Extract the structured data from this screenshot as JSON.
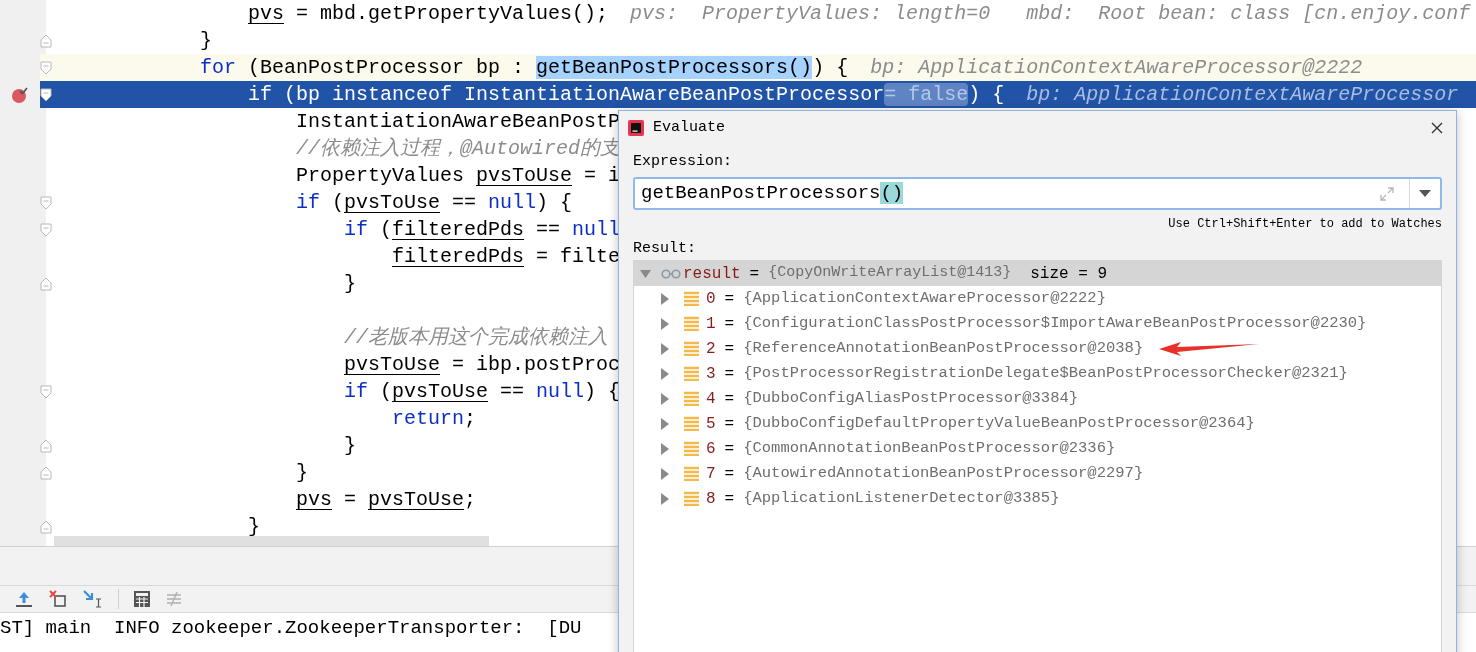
{
  "editor": {
    "lines": [
      {
        "children": [
          {
            "kind": "code",
            "code": [
              {
                "kind": "var",
                "text": "pvs"
              },
              {
                "kind": "text",
                "text": " = mbd.getPropertyValues();"
              }
            ],
            "hint": "pvs:  PropertyValues: length=0   mbd:  Root bean: class [cn.enjoy.conf"
          }
        ]
      },
      {
        "kind": "code",
        "fold_close": true,
        "code": [
          {
            "kind": "text",
            "text": "}"
          }
        ]
      },
      {
        "kind": "code",
        "caret": true,
        "fold_open": true,
        "code": [
          {
            "kind": "kw",
            "text": "for"
          },
          {
            "kind": "text",
            "text": " (BeanPostProcessor bp : "
          },
          {
            "kind": "sel",
            "text": "getBeanPostProcessors()"
          },
          {
            "kind": "text",
            "text": ") {"
          }
        ],
        "hint": "bp: ApplicationContextAwareProcessor@2222",
        "children": [
          {
            "kind": "code",
            "breakpoint": true,
            "current": true,
            "fold_open": true,
            "code": [
              {
                "kind": "kw",
                "text": "if"
              },
              {
                "kind": "text",
                "text": " (bp "
              },
              {
                "kind": "kw",
                "text": "instanceof"
              },
              {
                "kind": "text",
                "text": " InstantiationAwareBeanPostProcessor"
              },
              {
                "kind": "pill",
                "text": "= false"
              },
              {
                "kind": "text",
                "text": ") {"
              }
            ],
            "hint": "bp: ApplicationContextAwareProcessor",
            "children": [
              {
                "kind": "code",
                "code": [
                  {
                    "kind": "text",
                    "text": "InstantiationAwareBeanPostP"
                  }
                ]
              },
              {
                "kind": "code",
                "code": [
                  {
                    "kind": "comment",
                    "text": "//依赖注入过程，@Autowired的支"
                  }
                ]
              },
              {
                "kind": "code",
                "code": [
                  {
                    "kind": "text",
                    "text": "PropertyValues "
                  },
                  {
                    "kind": "var",
                    "text": "pvsToUse"
                  },
                  {
                    "kind": "text",
                    "text": " = i"
                  }
                ]
              },
              {
                "kind": "code",
                "fold_open": true,
                "code": [
                  {
                    "kind": "kw",
                    "text": "if"
                  },
                  {
                    "kind": "text",
                    "text": " ("
                  },
                  {
                    "kind": "var",
                    "text": "pvsToUse"
                  },
                  {
                    "kind": "text",
                    "text": " == "
                  },
                  {
                    "kind": "kw",
                    "text": "null"
                  },
                  {
                    "kind": "text",
                    "text": ") {"
                  }
                ],
                "children": [
                  {
                    "kind": "code",
                    "fold_open": true,
                    "code": [
                      {
                        "kind": "kw",
                        "text": "if"
                      },
                      {
                        "kind": "text",
                        "text": " ("
                      },
                      {
                        "kind": "var",
                        "text": "filteredPds"
                      },
                      {
                        "kind": "text",
                        "text": " == "
                      },
                      {
                        "kind": "kw",
                        "text": "null"
                      }
                    ],
                    "children": [
                      {
                        "kind": "code",
                        "code": [
                          {
                            "kind": "var",
                            "text": "filteredPds"
                          },
                          {
                            "kind": "text",
                            "text": " = filte"
                          }
                        ]
                      }
                    ]
                  },
                  {
                    "kind": "code",
                    "fold_close": true,
                    "code": [
                      {
                        "kind": "text",
                        "text": "}"
                      }
                    ]
                  },
                  {
                    "kind": "blank"
                  },
                  {
                    "kind": "code",
                    "code": [
                      {
                        "kind": "comment",
                        "text": "//老版本用这个完成依赖注入"
                      }
                    ]
                  },
                  {
                    "kind": "code",
                    "code": [
                      {
                        "kind": "var",
                        "text": "pvsToUse"
                      },
                      {
                        "kind": "text",
                        "text": " = ibp.postProc"
                      }
                    ]
                  },
                  {
                    "kind": "code",
                    "fold_open": true,
                    "code": [
                      {
                        "kind": "kw",
                        "text": "if"
                      },
                      {
                        "kind": "text",
                        "text": " ("
                      },
                      {
                        "kind": "var",
                        "text": "pvsToUse"
                      },
                      {
                        "kind": "text",
                        "text": " == "
                      },
                      {
                        "kind": "kw",
                        "text": "null"
                      },
                      {
                        "kind": "text",
                        "text": ") {"
                      }
                    ],
                    "children": [
                      {
                        "kind": "code",
                        "code": [
                          {
                            "kind": "kw",
                            "text": "return"
                          },
                          {
                            "kind": "text",
                            "text": ";"
                          }
                        ]
                      }
                    ]
                  },
                  {
                    "kind": "code",
                    "fold_close": true,
                    "code": [
                      {
                        "kind": "text",
                        "text": "}"
                      }
                    ]
                  }
                ]
              },
              {
                "kind": "code",
                "fold_close": true,
                "code": [
                  {
                    "kind": "text",
                    "text": "}"
                  }
                ]
              },
              {
                "kind": "code",
                "code": [
                  {
                    "kind": "var",
                    "text": "pvs"
                  },
                  {
                    "kind": "text",
                    "text": " = "
                  },
                  {
                    "kind": "var",
                    "text": "pvsToUse"
                  },
                  {
                    "kind": "text",
                    "text": ";"
                  }
                ]
              }
            ]
          },
          {
            "kind": "code",
            "fold_close": true,
            "code": [
              {
                "kind": "text",
                "text": "}"
              }
            ]
          }
        ]
      }
    ]
  },
  "console": {
    "lines": [
      "ST] main  INFO zookeeper.ZookeeperTransporter:  [DU"
    ]
  },
  "evaluate": {
    "title": "Evaluate",
    "expression_label": "Expression:",
    "expression": "getBeanPostProcessors",
    "expression_match": "()",
    "hint": "Use Ctrl+Shift+Enter to add to Watches",
    "result_label": "Result:",
    "result": {
      "name": "result",
      "op": "=",
      "value": "{CopyOnWriteArrayList@1413}",
      "extra": "size = 9",
      "expanded": true,
      "selected": true,
      "children": [
        {
          "name": "0",
          "op": "=",
          "value": "{ApplicationContextAwareProcessor@2222}"
        },
        {
          "name": "1",
          "op": "=",
          "value": "{ConfigurationClassPostProcessor$ImportAwareBeanPostProcessor@2230}"
        },
        {
          "name": "2",
          "op": "=",
          "value": "{ReferenceAnnotationBeanPostProcessor@2038}",
          "marked": true
        },
        {
          "name": "3",
          "op": "=",
          "value": "{PostProcessorRegistrationDelegate$BeanPostProcessorChecker@2321}"
        },
        {
          "name": "4",
          "op": "=",
          "value": "{DubboConfigAliasPostProcessor@3384}"
        },
        {
          "name": "5",
          "op": "=",
          "value": "{DubboConfigDefaultPropertyValueBeanPostProcessor@2364}"
        },
        {
          "name": "6",
          "op": "=",
          "value": "{CommonAnnotationBeanPostProcessor@2336}"
        },
        {
          "name": "7",
          "op": "=",
          "value": "{AutowiredAnnotationBeanPostProcessor@2297}"
        },
        {
          "name": "8",
          "op": "=",
          "value": "{ApplicationListenerDetector@3385}"
        }
      ]
    }
  }
}
